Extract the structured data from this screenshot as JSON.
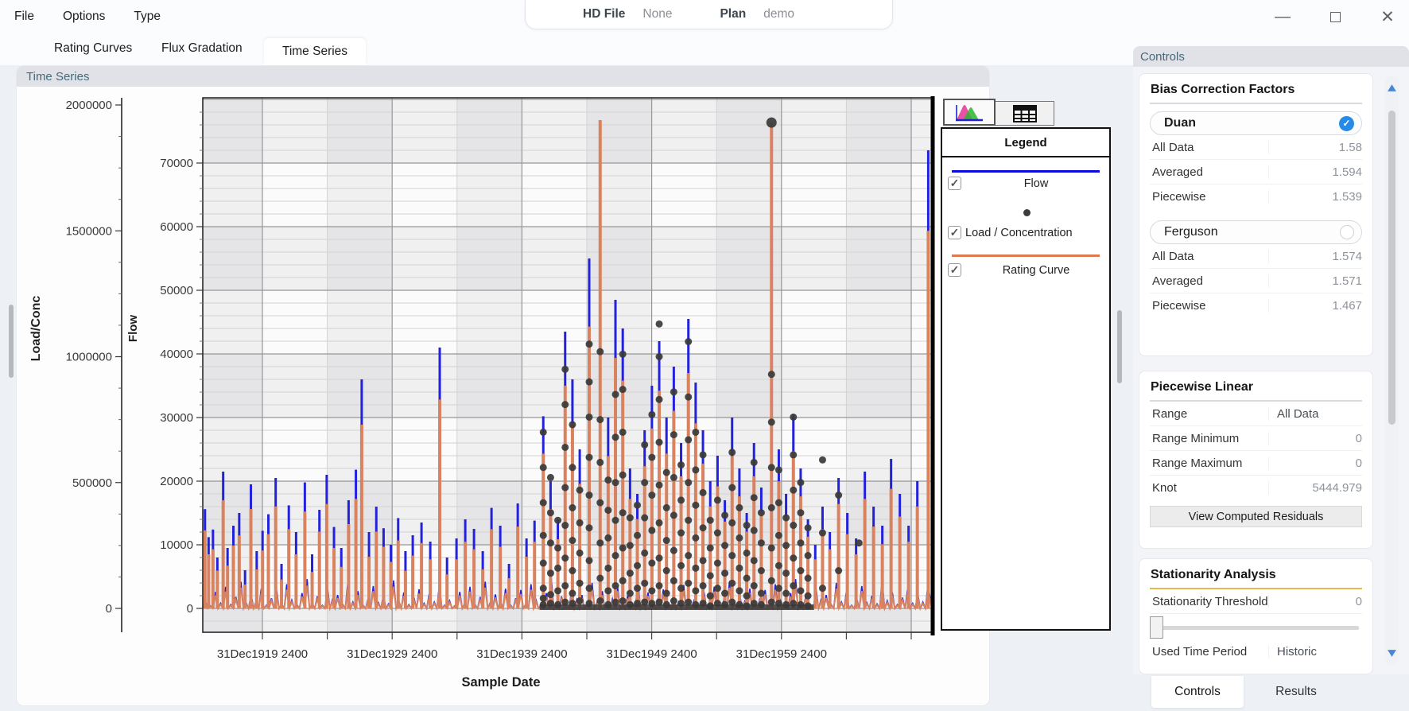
{
  "titlebar": {
    "menu": [
      "File",
      "Options",
      "Type"
    ],
    "hd_file_label": "HD File",
    "hd_file_value": "None",
    "plan_label": "Plan",
    "plan_value": "demo"
  },
  "main_tabs": {
    "tab1": "Rating Curves",
    "tab2": "Flux Gradation",
    "tab3": "Time Series",
    "active": "Time Series"
  },
  "chart_panel": {
    "title": "Time Series"
  },
  "legend": {
    "title": "Legend",
    "entries": [
      {
        "label": "Flow",
        "marker": "line",
        "color": "#0b0bdf",
        "checked": true
      },
      {
        "label": "Load / Concentration",
        "marker": "dot",
        "color": "#3c3c3c",
        "checked": true
      },
      {
        "label": "Rating Curve",
        "marker": "line",
        "color": "#df7a50",
        "checked": true
      }
    ],
    "view_tabs": [
      "plot-view",
      "table-view"
    ]
  },
  "chart_data": {
    "type": "line",
    "title": "Time Series",
    "xlabel": "Sample Date",
    "x_axis": {
      "tick_labels": [
        "31Dec1919 2400",
        "31Dec1929 2400",
        "31Dec1939 2400",
        "31Dec1949 2400",
        "31Dec1959 2400"
      ]
    },
    "flow_axis": {
      "label": "Flow",
      "ticks": [
        "0",
        "10000",
        "20000",
        "30000",
        "40000",
        "50000",
        "60000",
        "70000"
      ],
      "range": [
        0,
        80000
      ]
    },
    "load_axis": {
      "label": "Load/Conc",
      "ticks": [
        "0",
        "500000",
        "1000000",
        "1500000",
        "2000000"
      ],
      "range": [
        0,
        2030000
      ]
    },
    "series_names": [
      "Flow",
      "Load / Concentration",
      "Rating Curve"
    ],
    "colors": {
      "flow": "#2222dd",
      "rating": "#d9825f",
      "dots": "#3a3a3a",
      "band": "rgba(60,60,70,0.055)",
      "grid_minor": "#d2d2d2",
      "grid_major": "#979797"
    },
    "spikes": [
      [
        0.003,
        15.6,
        310
      ],
      [
        0.008,
        11.2,
        215
      ],
      [
        0.014,
        12.4,
        235
      ],
      [
        0.02,
        8,
        150
      ],
      [
        0.028,
        21.5,
        430
      ],
      [
        0.034,
        9.5,
        170
      ],
      [
        0.042,
        13,
        250
      ],
      [
        0.05,
        15,
        290
      ],
      [
        0.058,
        6,
        95
      ],
      [
        0.066,
        19.5,
        395
      ],
      [
        0.074,
        9,
        155
      ],
      [
        0.082,
        12.2,
        230
      ],
      [
        0.09,
        14.8,
        295
      ],
      [
        0.1,
        20.5,
        405
      ],
      [
        0.108,
        7,
        115
      ],
      [
        0.118,
        16.2,
        315
      ],
      [
        0.128,
        12,
        215
      ],
      [
        0.14,
        19.8,
        385
      ],
      [
        0.15,
        8.5,
        145
      ],
      [
        0.16,
        15.5,
        305
      ],
      [
        0.17,
        21,
        415
      ],
      [
        0.18,
        12.8,
        240
      ],
      [
        0.19,
        9.5,
        165
      ],
      [
        0.2,
        17,
        335
      ],
      [
        0.21,
        21.8,
        435
      ],
      [
        0.218,
        36,
        730
      ],
      [
        0.228,
        12,
        205
      ],
      [
        0.238,
        16,
        305
      ],
      [
        0.248,
        12.6,
        245
      ],
      [
        0.258,
        10,
        185
      ],
      [
        0.268,
        14.2,
        270
      ],
      [
        0.278,
        9,
        150
      ],
      [
        0.288,
        11.5,
        210
      ],
      [
        0.3,
        13.5,
        260
      ],
      [
        0.312,
        10.5,
        195
      ],
      [
        0.325,
        41,
        830
      ],
      [
        0.335,
        8,
        135
      ],
      [
        0.348,
        11,
        195
      ],
      [
        0.36,
        14,
        265
      ],
      [
        0.372,
        12.5,
        235
      ],
      [
        0.384,
        9,
        155
      ],
      [
        0.396,
        15.8,
        315
      ],
      [
        0.408,
        13,
        245
      ],
      [
        0.42,
        7,
        120
      ],
      [
        0.432,
        16.5,
        325
      ],
      [
        0.444,
        11,
        205
      ],
      [
        0.455,
        13.8,
        265
      ],
      [
        0.467,
        30.2,
        615
      ],
      [
        0.477,
        20,
        395
      ],
      [
        0.487,
        14,
        275
      ],
      [
        0.497,
        43.5,
        885
      ],
      [
        0.507,
        36,
        735
      ],
      [
        0.517,
        25,
        495
      ],
      [
        0.53,
        55,
        1120
      ],
      [
        0.545,
        74.5,
        1940
      ],
      [
        0.556,
        30,
        605
      ],
      [
        0.566,
        48.5,
        995
      ],
      [
        0.576,
        44,
        905
      ],
      [
        0.586,
        22,
        435
      ],
      [
        0.596,
        18,
        355
      ],
      [
        0.606,
        28,
        565
      ],
      [
        0.616,
        35,
        715
      ],
      [
        0.626,
        42,
        865
      ],
      [
        0.636,
        30,
        615
      ],
      [
        0.646,
        38,
        785
      ],
      [
        0.656,
        26,
        525
      ],
      [
        0.666,
        45.5,
        935
      ],
      [
        0.676,
        35.5,
        735
      ],
      [
        0.686,
        28,
        575
      ],
      [
        0.696,
        20,
        405
      ],
      [
        0.706,
        24,
        485
      ],
      [
        0.716,
        17,
        345
      ],
      [
        0.726,
        30,
        605
      ],
      [
        0.736,
        22,
        445
      ],
      [
        0.746,
        15,
        305
      ],
      [
        0.756,
        26,
        525
      ],
      [
        0.766,
        19,
        385
      ],
      [
        0.78,
        68.5,
        1930
      ],
      [
        0.79,
        25,
        505
      ],
      [
        0.8,
        18,
        365
      ],
      [
        0.81,
        30.5,
        625
      ],
      [
        0.82,
        22,
        445
      ],
      [
        0.83,
        14,
        285
      ],
      [
        0.84,
        10,
        195
      ],
      [
        0.85,
        16,
        315
      ],
      [
        0.86,
        12,
        235
      ],
      [
        0.872,
        20.5,
        415
      ],
      [
        0.884,
        15,
        295
      ],
      [
        0.896,
        11,
        215
      ],
      [
        0.908,
        21.5,
        435
      ],
      [
        0.92,
        16,
        325
      ],
      [
        0.932,
        13,
        255
      ],
      [
        0.944,
        23.5,
        475
      ],
      [
        0.956,
        18,
        365
      ],
      [
        0.968,
        13,
        265
      ],
      [
        0.98,
        20,
        405
      ],
      [
        0.995,
        72,
        1500
      ]
    ],
    "dot_strings": [
      {
        "f": 0.467,
        "loads": [
          15,
          40,
          80,
          180,
          290,
          420,
          560,
          700
        ]
      },
      {
        "f": 0.477,
        "loads": [
          20,
          55,
          140,
          260,
          380,
          520
        ]
      },
      {
        "f": 0.487,
        "loads": [
          15,
          70,
          160,
          240,
          350
        ]
      },
      {
        "f": 0.497,
        "loads": [
          25,
          90,
          200,
          330,
          480,
          640,
          810,
          950
        ]
      },
      {
        "f": 0.507,
        "loads": [
          20,
          60,
          150,
          270,
          400,
          560,
          730
        ]
      },
      {
        "f": 0.517,
        "loads": [
          30,
          100,
          220,
          340,
          470
        ]
      },
      {
        "f": 0.53,
        "loads": [
          20,
          80,
          190,
          320,
          450,
          600,
          760,
          900,
          1050
        ]
      },
      {
        "f": 0.545,
        "loads": [
          30,
          120,
          260,
          420,
          580,
          750,
          1020
        ]
      },
      {
        "f": 0.556,
        "loads": [
          15,
          70,
          160,
          280,
          390,
          510
        ]
      },
      {
        "f": 0.566,
        "loads": [
          25,
          90,
          210,
          350,
          500,
          680,
          850
        ]
      },
      {
        "f": 0.576,
        "loads": [
          30,
          110,
          240,
          380,
          530,
          700,
          870,
          1010
        ]
      },
      {
        "f": 0.586,
        "loads": [
          15,
          60,
          140,
          250,
          360
        ]
      },
      {
        "f": 0.596,
        "loads": [
          20,
          80,
          170,
          290,
          410
        ]
      },
      {
        "f": 0.606,
        "loads": [
          25,
          100,
          220,
          360,
          500,
          650
        ]
      },
      {
        "f": 0.616,
        "loads": [
          20,
          70,
          180,
          310,
          450,
          600,
          770
        ]
      },
      {
        "f": 0.626,
        "loads": [
          25,
          90,
          200,
          340,
          490,
          660,
          830,
          1000,
          1130
        ]
      },
      {
        "f": 0.636,
        "loads": [
          15,
          60,
          150,
          270,
          400,
          540
        ]
      },
      {
        "f": 0.646,
        "loads": [
          30,
          110,
          230,
          370,
          520,
          690,
          860
        ]
      },
      {
        "f": 0.656,
        "loads": [
          20,
          80,
          170,
          300,
          430,
          570
        ]
      },
      {
        "f": 0.666,
        "loads": [
          25,
          100,
          210,
          350,
          500,
          670,
          840,
          1060
        ]
      },
      {
        "f": 0.676,
        "loads": [
          15,
          70,
          160,
          280,
          410,
          550,
          700
        ]
      },
      {
        "f": 0.686,
        "loads": [
          20,
          90,
          190,
          320,
          460,
          610
        ]
      },
      {
        "f": 0.696,
        "loads": [
          10,
          50,
          130,
          240,
          350
        ]
      },
      {
        "f": 0.706,
        "loads": [
          20,
          80,
          180,
          300,
          430
        ]
      },
      {
        "f": 0.716,
        "loads": [
          15,
          60,
          140,
          250,
          370
        ]
      },
      {
        "f": 0.726,
        "loads": [
          25,
          100,
          210,
          340,
          480,
          620
        ]
      },
      {
        "f": 0.736,
        "loads": [
          15,
          70,
          160,
          280,
          400
        ]
      },
      {
        "f": 0.746,
        "loads": [
          10,
          50,
          120,
          220,
          330
        ]
      },
      {
        "f": 0.756,
        "loads": [
          20,
          90,
          190,
          310,
          440,
          580
        ]
      },
      {
        "f": 0.766,
        "loads": [
          15,
          60,
          150,
          260,
          380
        ]
      },
      {
        "f": 0.78,
        "loads": [
          25,
          110,
          240,
          400,
          560,
          740,
          930,
          1930
        ]
      },
      {
        "f": 0.79,
        "loads": [
          20,
          80,
          170,
          290,
          420,
          550
        ]
      },
      {
        "f": 0.8,
        "loads": [
          15,
          60,
          140,
          250,
          360
        ]
      },
      {
        "f": 0.81,
        "loads": [
          20,
          90,
          200,
          330,
          470,
          610,
          760
        ]
      },
      {
        "f": 0.82,
        "loads": [
          15,
          70,
          150,
          260,
          380,
          500
        ]
      },
      {
        "f": 0.83,
        "loads": [
          10,
          50,
          120,
          210,
          320
        ]
      },
      {
        "f": 0.85,
        "loads": [
          80,
          300,
          590
        ]
      },
      {
        "f": 0.872,
        "loads": [
          150,
          450
        ]
      },
      {
        "f": 0.9,
        "loads": [
          260
        ]
      }
    ],
    "noise": [
      1.2,
      0.4,
      2.6,
      0.8,
      3.4,
      0.6,
      1.8,
      4.2,
      0.9,
      2.2,
      1.1,
      3.1,
      0.5,
      1.6,
      2.9,
      0.7,
      3.8,
      1.3,
      0.6,
      2.4,
      4.6,
      0.8,
      1.9,
      0.5,
      3.2,
      1.4,
      2.1,
      0.6,
      4.0,
      1.0,
      2.7,
      0.5,
      1.5,
      3.5,
      0.9,
      2.0,
      0.7,
      4.4,
      1.2,
      2.5,
      0.6,
      1.7,
      3.0,
      0.8,
      2.3,
      1.0,
      3.7,
      0.5
    ],
    "baseline_band": {
      "from": 0.462,
      "to": 0.838
    }
  },
  "controls": {
    "header": "Controls",
    "bias": {
      "heading": "Bias Correction Factors",
      "methods": [
        {
          "name": "Duan",
          "selected": true,
          "rows": [
            {
              "label": "All Data",
              "value": "1.58"
            },
            {
              "label": "Averaged",
              "value": "1.594"
            },
            {
              "label": "Piecewise",
              "value": "1.539"
            }
          ]
        },
        {
          "name": "Ferguson",
          "selected": false,
          "rows": [
            {
              "label": "All Data",
              "value": "1.574"
            },
            {
              "label": "Averaged",
              "value": "1.571"
            },
            {
              "label": "Piecewise",
              "value": "1.467"
            }
          ]
        }
      ]
    },
    "piecewise": {
      "heading": "Piecewise Linear",
      "rows": [
        {
          "label": "Range",
          "value": "All Data"
        },
        {
          "label": "Range Minimum",
          "value": "0"
        },
        {
          "label": "Range Maximum",
          "value": "0"
        },
        {
          "label": "Knot",
          "value": "5444.979"
        }
      ],
      "button": "View Computed Residuals"
    },
    "stationarity": {
      "heading": "Stationarity Analysis",
      "threshold_label": "Stationarity Threshold",
      "threshold_value": "0",
      "slider_value": 0,
      "used_time_label": "Used Time Period",
      "used_time_value": "Historic"
    },
    "bottom_tabs": {
      "tab1": "Controls",
      "tab2": "Results",
      "active": "Controls"
    }
  }
}
